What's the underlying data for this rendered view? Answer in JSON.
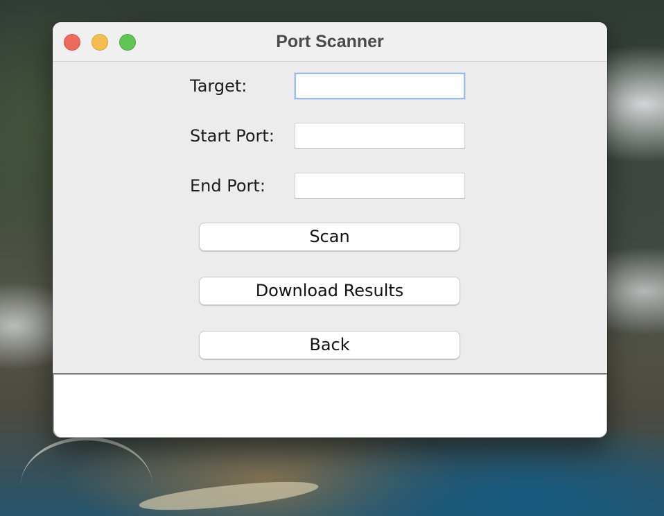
{
  "window": {
    "title": "Port Scanner"
  },
  "traffic_lights": {
    "close_color": "#ee6a5f",
    "minimize_color": "#f5bd4f",
    "zoom_color": "#61c554"
  },
  "form": {
    "target": {
      "label": "Target:",
      "value": "",
      "placeholder": ""
    },
    "start_port": {
      "label": "Start Port:",
      "value": "",
      "placeholder": ""
    },
    "end_port": {
      "label": "End Port:",
      "value": "",
      "placeholder": ""
    }
  },
  "buttons": {
    "scan": "Scan",
    "download": "Download Results",
    "back": "Back"
  },
  "output": {
    "text": ""
  },
  "colors": {
    "window_background": "#ececec",
    "focus_ring": "#9dbbe7"
  }
}
